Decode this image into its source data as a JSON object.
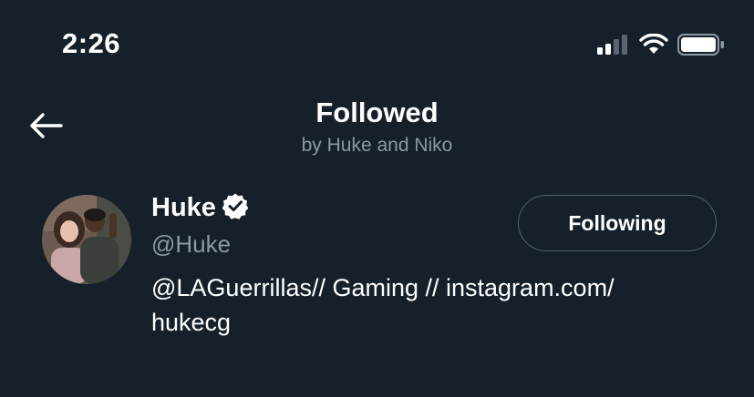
{
  "status_bar": {
    "time": "2:26",
    "icons": [
      "cellular-signal-icon",
      "wifi-icon",
      "battery-icon"
    ]
  },
  "header": {
    "back_icon": "back-arrow-icon",
    "title": "Followed",
    "subtitle": "by Huke and Niko"
  },
  "user": {
    "display_name": "Huke",
    "verified_icon": "verified-badge-icon",
    "handle": "@Huke",
    "bio_line1": "@LAGuerrillas// Gaming // instagram.com/",
    "bio_line2": "hukecg",
    "follow_button_label": "Following"
  },
  "colors": {
    "background": "#15202b",
    "text_primary": "#ffffff",
    "text_secondary": "#8b98a5",
    "button_border": "#536471"
  }
}
